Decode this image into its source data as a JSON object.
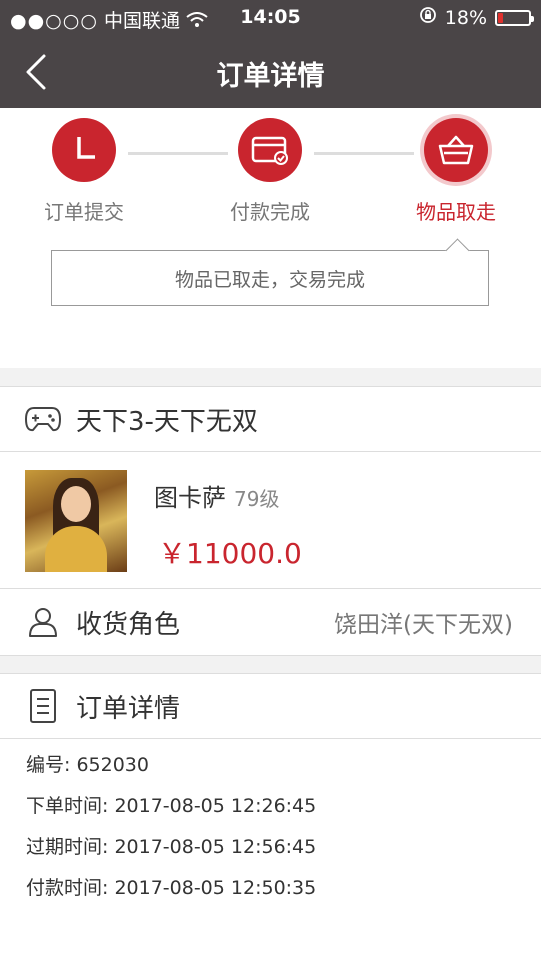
{
  "status_bar": {
    "signal": "●●○○○",
    "carrier": "中国联通",
    "time": "14:05",
    "battery": "18%",
    "battery_level": 0.18
  },
  "nav": {
    "title": "订单详情"
  },
  "progress": {
    "steps": [
      {
        "label": "订单提交",
        "icon": "clock-icon"
      },
      {
        "label": "付款完成",
        "icon": "card-paid-icon"
      },
      {
        "label": "物品取走",
        "icon": "basket-icon"
      }
    ],
    "tip": "物品已取走，交易完成"
  },
  "game": {
    "name": "天下3-天下无双"
  },
  "product": {
    "name": "图卡萨",
    "level": "79级",
    "price": "￥11000.0"
  },
  "receiver": {
    "label": "收货角色",
    "value": "饶田洋(天下无双)"
  },
  "order": {
    "heading": "订单详情",
    "rows": [
      "编号: 652030",
      "下单时间: 2017-08-05 12:26:45",
      "过期时间: 2017-08-05 12:56:45",
      "付款时间: 2017-08-05 12:50:35"
    ]
  },
  "colors": {
    "header": "#4a4547",
    "accent": "#c9252e"
  }
}
